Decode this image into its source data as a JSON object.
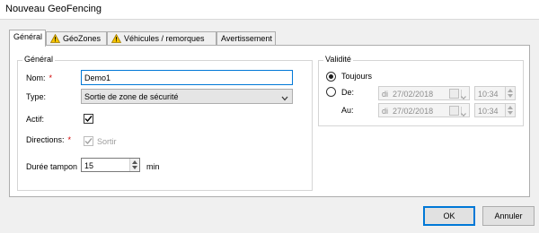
{
  "window": {
    "title": "Nouveau GeoFencing"
  },
  "tabs": [
    {
      "label": "Général",
      "active": true,
      "warning": false
    },
    {
      "label": "GéoZones",
      "active": false,
      "warning": true
    },
    {
      "label": "Véhicules / remorques",
      "active": false,
      "warning": true
    },
    {
      "label": "Avertissement",
      "active": false,
      "warning": false
    }
  ],
  "general": {
    "legend": "Général",
    "nom": {
      "label": "Nom:",
      "required_marker": "*",
      "value": "Demo1"
    },
    "type": {
      "label": "Type:",
      "selected": "Sortie de zone de sécurité"
    },
    "actif": {
      "label": "Actif:",
      "checked": true
    },
    "directions": {
      "label": "Directions:",
      "required_marker": "*",
      "option_label": "Sortir",
      "checked": true,
      "disabled": true
    },
    "duree": {
      "label": "Durée tampon",
      "value": "15",
      "unit": "min"
    }
  },
  "validite": {
    "legend": "Validité",
    "toujours": {
      "label": "Toujours",
      "selected": true
    },
    "de": {
      "label": "De:",
      "selected": false,
      "day": "di",
      "date": "27/02/2018",
      "time": "10:34"
    },
    "au": {
      "label": "Au:",
      "day": "di",
      "date": "27/02/2018",
      "time": "10:34"
    }
  },
  "buttons": {
    "ok": "OK",
    "cancel": "Annuler"
  },
  "colors": {
    "accent": "#0078d7",
    "required": "#d00000",
    "warning": "#f5c400"
  },
  "icons": {
    "warning": "warning-icon",
    "dropdown": "chevron-down-icon",
    "calendar": "calendar-icon",
    "check": "check-icon"
  }
}
